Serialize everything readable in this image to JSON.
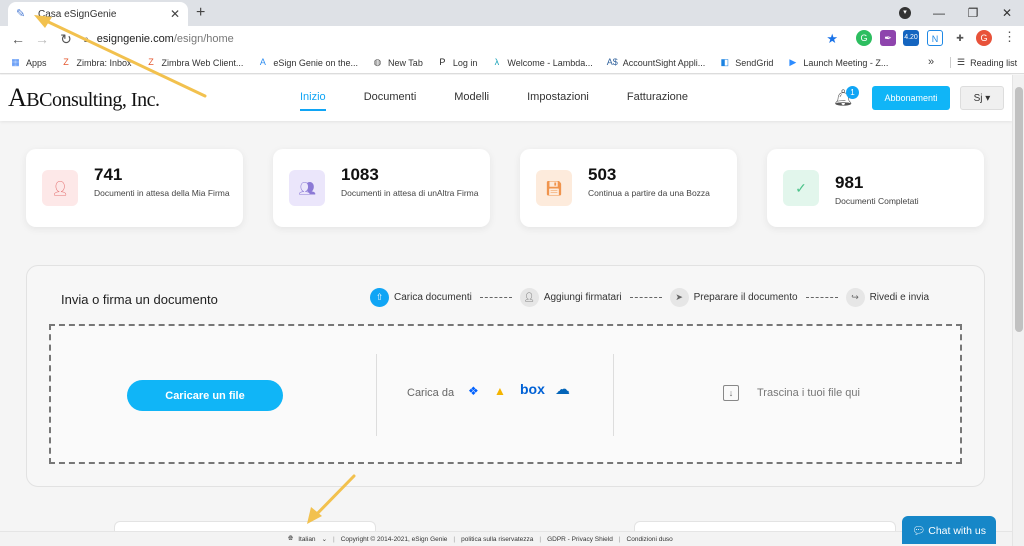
{
  "browser": {
    "tab_title": "Casa eSignGenie",
    "url_host": "esigngenie.com",
    "url_path": "/esign/home",
    "ext_badge": "4.20",
    "profile_initial": "G",
    "bookmarks": [
      {
        "label": "Apps",
        "icon": "apps-grid-icon",
        "color": "#4285f4"
      },
      {
        "label": "Zimbra: Inbox",
        "icon": "zimbra-icon",
        "color": "#e4572e"
      },
      {
        "label": "Zimbra Web Client...",
        "icon": "zimbra-icon",
        "color": "#e4572e"
      },
      {
        "label": "eSign Genie on the...",
        "icon": "app-store-icon",
        "color": "#2d8cf0"
      },
      {
        "label": "New Tab",
        "icon": "globe-icon",
        "color": "#555555"
      },
      {
        "label": "Log in",
        "icon": "p-icon",
        "color": "#222222"
      },
      {
        "label": "Welcome - Lambda...",
        "icon": "lambda-icon",
        "color": "#17a2b8"
      },
      {
        "label": "AccountSight Appli...",
        "icon": "accountsight-icon",
        "color": "#2d5f9a"
      },
      {
        "label": "SendGrid",
        "icon": "sendgrid-icon",
        "color": "#1a82e2"
      },
      {
        "label": "Launch Meeting - Z...",
        "icon": "zoom-icon",
        "color": "#2d8cff"
      }
    ],
    "reading_list": "Reading list"
  },
  "header": {
    "logo_big": "A",
    "logo_rest": "BConsulting, Inc.",
    "nav": [
      {
        "label": "Inizio",
        "active": true
      },
      {
        "label": "Documenti",
        "active": false
      },
      {
        "label": "Modelli",
        "active": false
      },
      {
        "label": "Impostazioni",
        "active": false
      },
      {
        "label": "Fatturazione",
        "active": false
      }
    ],
    "notification_count": "1",
    "subscribe_label": "Abbonamenti",
    "user_label": "Sj ▾"
  },
  "stats": [
    {
      "value": "741",
      "label": "Documenti in attesa della Mia Firma",
      "icon": "user-icon",
      "bg": "#fde8e8",
      "fg": "#e57373"
    },
    {
      "value": "1083",
      "label": "Documenti in attesa di unAltra Firma",
      "icon": "users-icon",
      "bg": "#ebe6fb",
      "fg": "#8c7ad6"
    },
    {
      "value": "503",
      "label": "Continua a partire da una Bozza",
      "icon": "draft-icon",
      "bg": "#fdebdc",
      "fg": "#f0944d"
    },
    {
      "value": "981",
      "label": "Documenti Completati",
      "icon": "check-icon",
      "bg": "#e2f6ec",
      "fg": "#4cc38a"
    }
  ],
  "upload": {
    "title": "Invia o firma un documento",
    "steps": [
      {
        "label": "Carica documenti",
        "active": true
      },
      {
        "label": "Aggiungi firmatari",
        "active": false
      },
      {
        "label": "Preparare il documento",
        "active": false
      },
      {
        "label": "Rivedi e invia",
        "active": false
      }
    ],
    "upload_button": "Caricare un file",
    "load_from": "Carica da",
    "box_label": "box",
    "drag_text": "Trascina i tuoi file qui"
  },
  "footer": {
    "language": "Italian",
    "copyright": "Copyright © 2014-2021, eSign Genie",
    "privacy": "politica sulla riservatezza",
    "gdpr": "GDPR - Privacy Shield",
    "terms": "Condizioni duso"
  },
  "chat_label": "Chat with us",
  "accent_color": "#10a5f5",
  "annotation_color": "#f2c14e"
}
